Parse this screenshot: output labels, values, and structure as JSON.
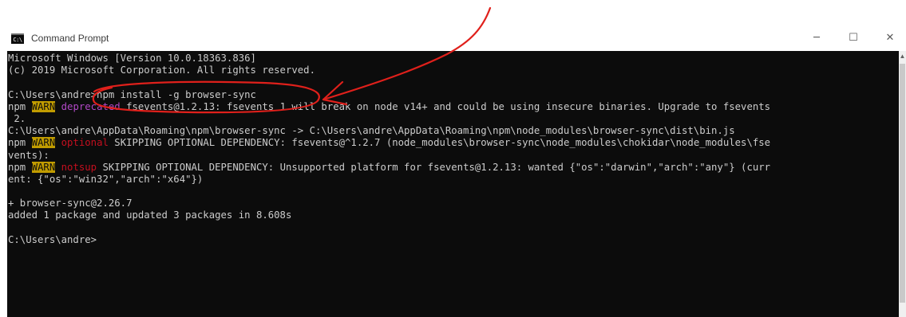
{
  "window": {
    "title": "Command Prompt",
    "icon_text": "C:\\",
    "minimize_glyph": "─",
    "maximize_glyph": "☐",
    "close_glyph": "✕"
  },
  "console": {
    "lines": [
      "Microsoft Windows [Version 10.0.18363.836]",
      "(c) 2019 Microsoft Corporation. All rights reserved.",
      "",
      "C:\\Users\\andre>npm install -g browser-sync",
      {
        "prefix": "npm ",
        "badge": "WARN",
        "tag": " deprecated",
        "rest": " fsevents@1.2.13: fsevents 1 will break on node v14+ and could be using insecure binaries. Upgrade to fsevents"
      },
      " 2.",
      "C:\\Users\\andre\\AppData\\Roaming\\npm\\browser-sync -> C:\\Users\\andre\\AppData\\Roaming\\npm\\node_modules\\browser-sync\\dist\\bin.js",
      {
        "prefix": "npm ",
        "badge": "WARN",
        "tag": " optional",
        "rest": " SKIPPING OPTIONAL DEPENDENCY: fsevents@^1.2.7 (node_modules\\browser-sync\\node_modules\\chokidar\\node_modules\\fse"
      },
      "vents):",
      {
        "prefix": "npm ",
        "badge": "WARN",
        "tag": " notsup",
        "rest": " SKIPPING OPTIONAL DEPENDENCY: Unsupported platform for fsevents@1.2.13: wanted {\"os\":\"darwin\",\"arch\":\"any\"} (curr"
      },
      "ent: {\"os\":\"win32\",\"arch\":\"x64\"})",
      "",
      "+ browser-sync@2.26.7",
      "added 1 package and updated 3 packages in 8.608s",
      "",
      "C:\\Users\\andre>"
    ]
  },
  "colors": {
    "console_background": "#0c0c0c",
    "console_text": "#cccccc",
    "warn_badge": "#c19c00",
    "annotation": "#e0201b"
  }
}
